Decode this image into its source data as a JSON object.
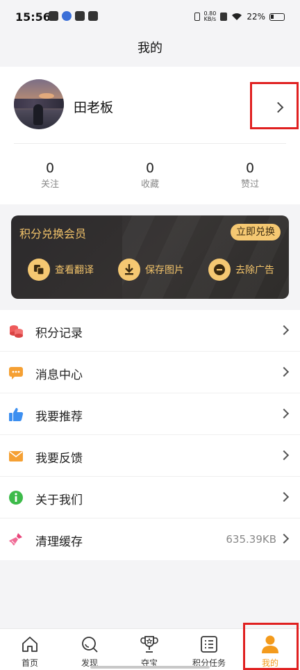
{
  "status_bar": {
    "time": "15:56",
    "net_speed_value": "0.80",
    "net_speed_unit": "KB/s",
    "battery": "22%"
  },
  "header": {
    "title": "我的"
  },
  "profile": {
    "username": "田老板",
    "stats": [
      {
        "count": "0",
        "label": "关注"
      },
      {
        "count": "0",
        "label": "收藏"
      },
      {
        "count": "0",
        "label": "赞过"
      }
    ]
  },
  "vip": {
    "title": "积分兑换会员",
    "button": "立即兑换",
    "features": [
      {
        "label": "查看翻译",
        "icon": "translate-icon"
      },
      {
        "label": "保存图片",
        "icon": "download-icon"
      },
      {
        "label": "去除广告",
        "icon": "remove-ads-icon"
      }
    ],
    "colors": {
      "accent": "#f5c872",
      "background": "#2c2a2c"
    }
  },
  "menu": [
    {
      "label": "积分记录",
      "icon": "coins-icon",
      "value": ""
    },
    {
      "label": "消息中心",
      "icon": "message-icon",
      "value": ""
    },
    {
      "label": "我要推荐",
      "icon": "thumbs-up-icon",
      "value": ""
    },
    {
      "label": "我要反馈",
      "icon": "feedback-mail-icon",
      "value": ""
    },
    {
      "label": "关于我们",
      "icon": "info-icon",
      "value": ""
    },
    {
      "label": "清理缓存",
      "icon": "broom-icon",
      "value": "635.39KB"
    }
  ],
  "tabbar": {
    "items": [
      {
        "label": "首页",
        "icon": "home-icon"
      },
      {
        "label": "发现",
        "icon": "search-icon"
      },
      {
        "label": "夺宝",
        "icon": "trophy-icon"
      },
      {
        "label": "积分任务",
        "icon": "task-list-icon"
      },
      {
        "label": "我的",
        "icon": "person-icon"
      }
    ],
    "active": "我的",
    "active_color": "#f39a1c"
  },
  "highlight_color": "#e02020"
}
